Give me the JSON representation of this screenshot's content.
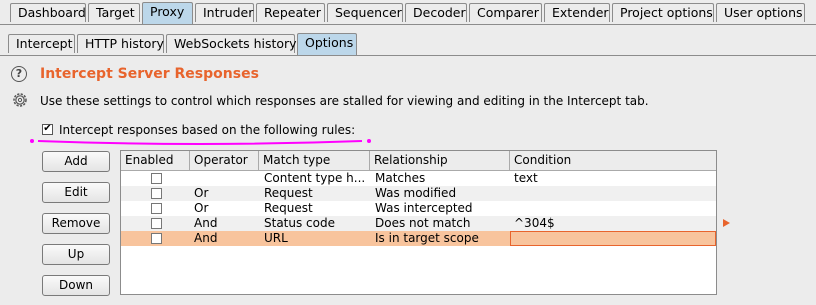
{
  "main_tabs": [
    "Dashboard",
    "Target",
    "Proxy",
    "Intruder",
    "Repeater",
    "Sequencer",
    "Decoder",
    "Comparer",
    "Extender",
    "Project options",
    "User options"
  ],
  "sub_tabs": [
    "Intercept",
    "HTTP history",
    "WebSockets history",
    "Options"
  ],
  "section": {
    "title": "Intercept Server Responses",
    "description": "Use these settings to control which responses are stalled for viewing and editing in the Intercept tab.",
    "checkbox_label": "Intercept responses based on the following rules:",
    "checkbox_checked": true
  },
  "buttons": [
    "Add",
    "Edit",
    "Remove",
    "Up",
    "Down"
  ],
  "table": {
    "columns": [
      "Enabled",
      "Operator",
      "Match type",
      "Relationship",
      "Condition"
    ],
    "rows": [
      {
        "enabled": false,
        "operator": "",
        "match_type": "Content type h...",
        "relationship": "Matches",
        "condition": "text"
      },
      {
        "enabled": false,
        "operator": "Or",
        "match_type": "Request",
        "relationship": "Was modified",
        "condition": ""
      },
      {
        "enabled": false,
        "operator": "Or",
        "match_type": "Request",
        "relationship": "Was intercepted",
        "condition": ""
      },
      {
        "enabled": false,
        "operator": "And",
        "match_type": "Status code",
        "relationship": "Does not match",
        "condition": "^304$"
      },
      {
        "enabled": false,
        "operator": "And",
        "match_type": "URL",
        "relationship": "Is in target scope",
        "condition": ""
      }
    ]
  },
  "colors": {
    "accent": "#e8642d",
    "selected_row": "#f8c49d",
    "active_tab": "#bcd7ea",
    "annotation": "#ff00ff"
  }
}
